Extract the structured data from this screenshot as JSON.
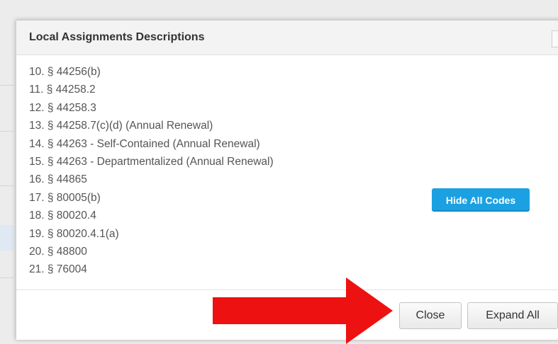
{
  "modal": {
    "title": "Local Assignments Descriptions"
  },
  "codes": [
    "10. § 44256(b)",
    "11. § 44258.2",
    "12. § 44258.3",
    "13. § 44258.7(c)(d) (Annual Renewal)",
    "14. § 44263 - Self-Contained (Annual Renewal)",
    "15. § 44263 - Departmentalized (Annual Renewal)",
    "16. § 44865",
    "17. § 80005(b)",
    "18. § 80020.4",
    "19. § 80020.4.1(a)",
    "20. § 48800",
    "21. § 76004"
  ],
  "buttons": {
    "hide_all_codes": "Hide All Codes",
    "close": "Close",
    "expand_all": "Expand All"
  },
  "colors": {
    "primary_button": "#1ba1e2",
    "annotation_arrow": "#ee1111"
  },
  "annotation": {
    "icon": "red-arrow-right-icon"
  }
}
